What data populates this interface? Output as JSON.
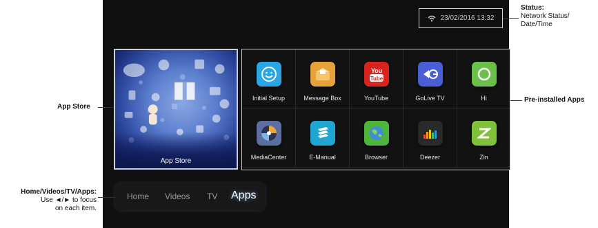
{
  "status": {
    "datetime": "23/02/2016 13:32",
    "wifi_icon": "wifi-icon"
  },
  "app_store": {
    "label": "App Store"
  },
  "apps": [
    {
      "label": "Initial Setup",
      "icon": "smiley-icon",
      "color": "#2aa6e6"
    },
    {
      "label": "Message Box",
      "icon": "mailbox-icon",
      "color": "#e8a23a"
    },
    {
      "label": "YouTube",
      "icon": "youtube-icon",
      "color": "#d8231f"
    },
    {
      "label": "GoLive TV",
      "icon": "golive-icon",
      "color": "#4a5fd6"
    },
    {
      "label": "Hi",
      "icon": "circle-icon",
      "color": "#6cc04a"
    },
    {
      "label": "MediaCenter",
      "icon": "media-center-icon",
      "color": "#5d6fa0"
    },
    {
      "label": "E-Manual",
      "icon": "book-icon",
      "color": "#1fa6d2"
    },
    {
      "label": "Browser",
      "icon": "globe-icon",
      "color": "#4fb43a"
    },
    {
      "label": "Deezer",
      "icon": "equalizer-icon",
      "color": "#2a2a2a"
    },
    {
      "label": "Zin",
      "icon": "zinio-icon",
      "color": "#7fc23a"
    }
  ],
  "nav": {
    "items": [
      "Home",
      "Videos",
      "TV",
      "Apps"
    ],
    "active": "Apps"
  },
  "callouts": {
    "status_title": "Status:",
    "status_line1": "Network Status/",
    "status_line2": "Date/Time",
    "app_store": "App Store",
    "preinstalled": "Pre-installed Apps",
    "nav_title": "Home/Videos/TV/Apps:",
    "nav_line1": "Use ◄/► to focus",
    "nav_line2": "on each item."
  }
}
